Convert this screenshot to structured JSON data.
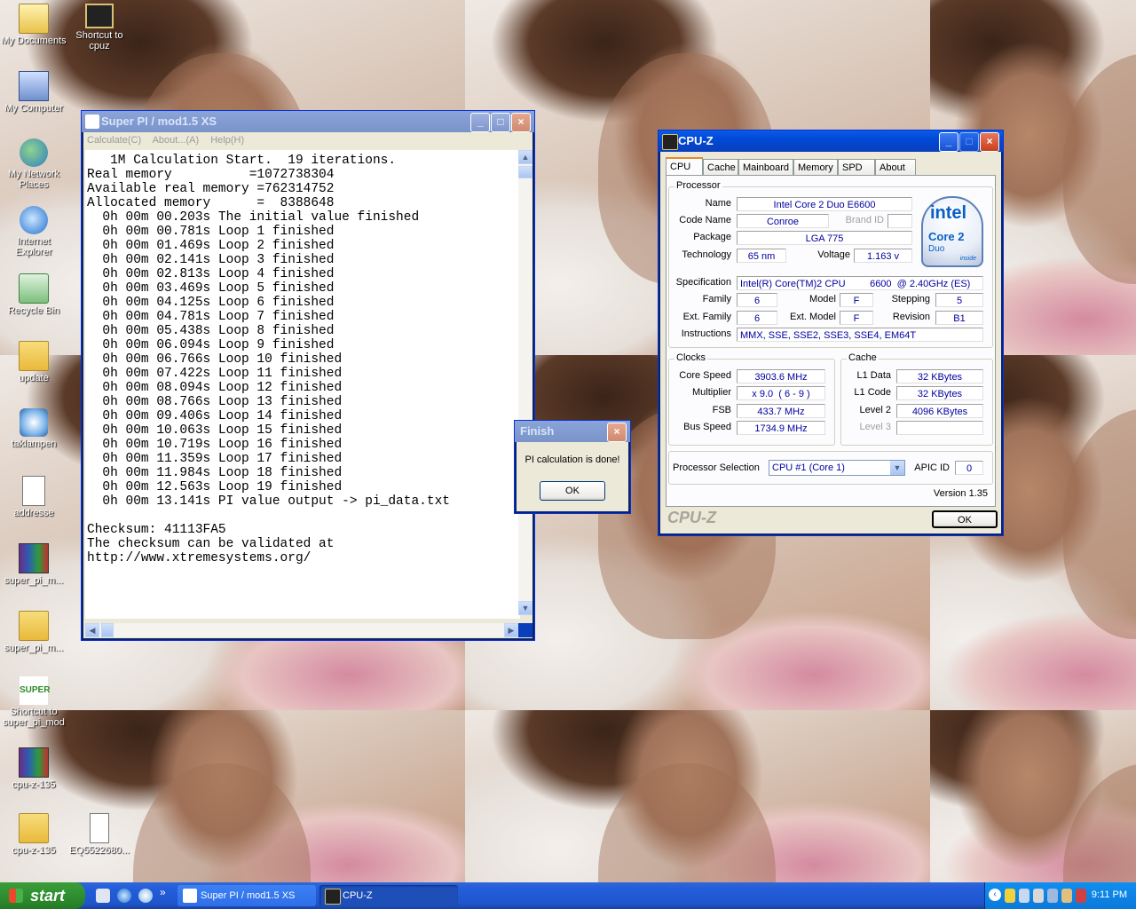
{
  "desktop": {
    "icons": [
      {
        "label": "My Documents"
      },
      {
        "label": "Shortcut to cpuz"
      },
      {
        "label": "My Computer"
      },
      {
        "label": "My Network Places"
      },
      {
        "label": "Internet Explorer"
      },
      {
        "label": "Recycle Bin"
      },
      {
        "label": "update"
      },
      {
        "label": "taklampen"
      },
      {
        "label": "addresse"
      },
      {
        "label": "super_pi_m..."
      },
      {
        "label": "super_pi_m..."
      },
      {
        "label": "Shortcut to super_pi_mod"
      },
      {
        "label": "cpu-z-135"
      },
      {
        "label": "cpu-z-135"
      },
      {
        "label": "EQ5522680..."
      }
    ]
  },
  "superpi": {
    "title": "Super PI / mod1.5 XS",
    "menu": [
      "Calculate(C)",
      "About...(A)",
      "Help(H)"
    ],
    "lines": [
      "   1M Calculation Start.  19 iterations.",
      "Real memory          =1072738304",
      "Available real memory =762314752",
      "Allocated memory      =  8388648",
      "  0h 00m 00.203s The initial value finished",
      "  0h 00m 00.781s Loop 1 finished",
      "  0h 00m 01.469s Loop 2 finished",
      "  0h 00m 02.141s Loop 3 finished",
      "  0h 00m 02.813s Loop 4 finished",
      "  0h 00m 03.469s Loop 5 finished",
      "  0h 00m 04.125s Loop 6 finished",
      "  0h 00m 04.781s Loop 7 finished",
      "  0h 00m 05.438s Loop 8 finished",
      "  0h 00m 06.094s Loop 9 finished",
      "  0h 00m 06.766s Loop 10 finished",
      "  0h 00m 07.422s Loop 11 finished",
      "  0h 00m 08.094s Loop 12 finished",
      "  0h 00m 08.766s Loop 13 finished",
      "  0h 00m 09.406s Loop 14 finished",
      "  0h 00m 10.063s Loop 15 finished",
      "  0h 00m 10.719s Loop 16 finished",
      "  0h 00m 11.359s Loop 17 finished",
      "  0h 00m 11.984s Loop 18 finished",
      "  0h 00m 12.563s Loop 19 finished",
      "  0h 00m 13.141s PI value output -> pi_data.txt",
      "",
      "Checksum: 41113FA5",
      "The checksum can be validated at",
      "http://www.xtremesystems.org/"
    ]
  },
  "finish": {
    "title": "Finish",
    "message": "PI calculation is done!",
    "ok": "OK"
  },
  "cpuz": {
    "title": "CPU-Z",
    "tabs": [
      "CPU",
      "Cache",
      "Mainboard",
      "Memory",
      "SPD",
      "About"
    ],
    "processor": {
      "group": "Processor",
      "name_label": "Name",
      "name": "Intel Core 2 Duo E6600",
      "codename_label": "Code Name",
      "codename": "Conroe",
      "brandid_label": "Brand ID",
      "package_label": "Package",
      "package": "LGA 775",
      "technology_label": "Technology",
      "technology": "65 nm",
      "voltage_label": "Voltage",
      "voltage": "1.163 v",
      "spec_label": "Specification",
      "spec": "Intel(R) Core(TM)2 CPU         6600  @ 2.40GHz (ES)",
      "family_label": "Family",
      "family": "6",
      "model_label": "Model",
      "model": "F",
      "stepping_label": "Stepping",
      "stepping": "5",
      "extfamily_label": "Ext. Family",
      "extfamily": "6",
      "extmodel_label": "Ext. Model",
      "extmodel": "F",
      "revision_label": "Revision",
      "revision": "B1",
      "instructions_label": "Instructions",
      "instructions": "MMX, SSE, SSE2, SSE3, SSE4, EM64T"
    },
    "logo": {
      "brand": "intel",
      "line1": "Core 2",
      "line2": "Duo",
      "line3": "inside"
    },
    "clocks": {
      "group": "Clocks",
      "corespeed_label": "Core Speed",
      "corespeed": "3903.6 MHz",
      "multiplier_label": "Multiplier",
      "multiplier": "x 9.0  ( 6 - 9 )",
      "fsb_label": "FSB",
      "fsb": "433.7 MHz",
      "busspeed_label": "Bus Speed",
      "busspeed": "1734.9 MHz"
    },
    "cache": {
      "group": "Cache",
      "l1data_label": "L1 Data",
      "l1data": "32 KBytes",
      "l1code_label": "L1 Code",
      "l1code": "32 KBytes",
      "level2_label": "Level 2",
      "level2": "4096 KBytes",
      "level3_label": "Level 3"
    },
    "selection": {
      "label": "Processor Selection",
      "value": "CPU #1 (Core 1)",
      "apic_label": "APIC ID",
      "apic": "0"
    },
    "version": "Version 1.35",
    "brand": "CPU-Z",
    "ok": "OK"
  },
  "taskbar": {
    "start": "start",
    "tasks": [
      "Super PI / mod1.5 XS",
      "CPU-Z"
    ],
    "clock": "9:11 PM"
  }
}
